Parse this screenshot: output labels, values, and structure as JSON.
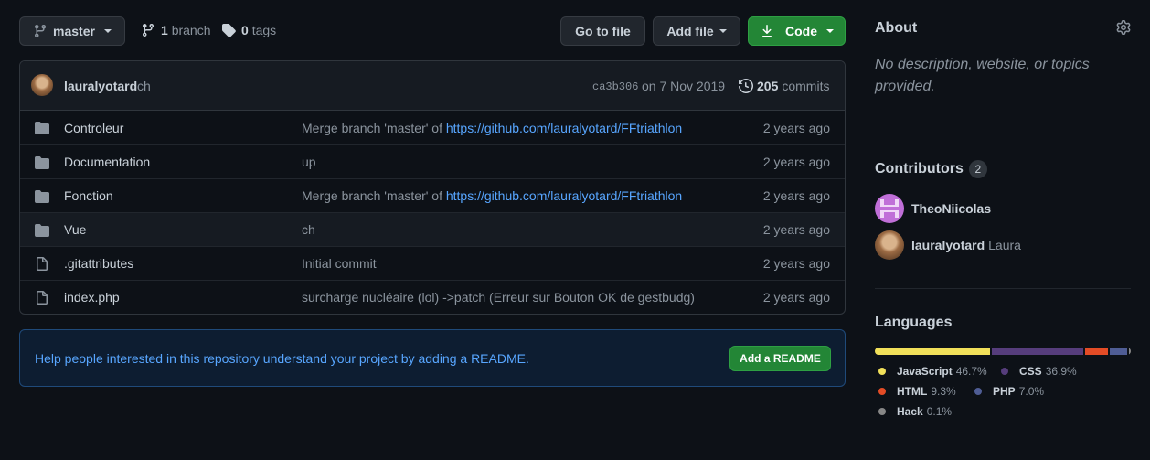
{
  "toolbar": {
    "branch_name": "master",
    "branch_count": "1",
    "branch_label": "branch",
    "tag_count": "0",
    "tag_label": "tags",
    "go_to_file": "Go to file",
    "add_file": "Add file",
    "code": "Code"
  },
  "commit": {
    "author": "lauralyotard",
    "message": "ch",
    "sha": "ca3b306",
    "date": "on 7 Nov 2019",
    "count": "205",
    "count_label": "commits"
  },
  "files": [
    {
      "type": "dir",
      "name": "Controleur",
      "msg_prefix": "Merge branch 'master' of ",
      "msg_link": "https://github.com/lauralyotard/FFtriathlon",
      "age": "2 years ago"
    },
    {
      "type": "dir",
      "name": "Documentation",
      "msg_prefix": "up",
      "msg_link": "",
      "age": "2 years ago"
    },
    {
      "type": "dir",
      "name": "Fonction",
      "msg_prefix": "Merge branch 'master' of ",
      "msg_link": "https://github.com/lauralyotard/FFtriathlon",
      "age": "2 years ago"
    },
    {
      "type": "dir",
      "name": "Vue",
      "msg_prefix": "ch",
      "msg_link": "",
      "age": "2 years ago"
    },
    {
      "type": "file",
      "name": ".gitattributes",
      "msg_prefix": "Initial commit",
      "msg_link": "",
      "age": "2 years ago"
    },
    {
      "type": "file",
      "name": "index.php",
      "msg_prefix": "surcharge nucléaire (lol) ->patch (Erreur sur Bouton OK de gestbudg)",
      "msg_link": "",
      "age": "2 years ago"
    }
  ],
  "readme": {
    "text": "Help people interested in this repository understand your project by adding a README.",
    "button": "Add a README"
  },
  "about": {
    "title": "About",
    "description": "No description, website, or topics provided."
  },
  "contributors": {
    "title": "Contributors",
    "count": "2",
    "list": [
      {
        "login": "TheoNiicolas",
        "name": ""
      },
      {
        "login": "lauralyotard",
        "name": "Laura"
      }
    ]
  },
  "languages": {
    "title": "Languages",
    "list": [
      {
        "name": "JavaScript",
        "pct": "46.7%",
        "value": 46.7,
        "color": "#f1e05a"
      },
      {
        "name": "CSS",
        "pct": "36.9%",
        "value": 36.9,
        "color": "#563d7c"
      },
      {
        "name": "HTML",
        "pct": "9.3%",
        "value": 9.3,
        "color": "#e34c26"
      },
      {
        "name": "PHP",
        "pct": "7.0%",
        "value": 7.0,
        "color": "#4f5d95"
      },
      {
        "name": "Hack",
        "pct": "0.1%",
        "value": 0.1,
        "color": "#878787"
      }
    ]
  },
  "colors": {
    "accent_green": "#238636",
    "link": "#58a6ff"
  }
}
